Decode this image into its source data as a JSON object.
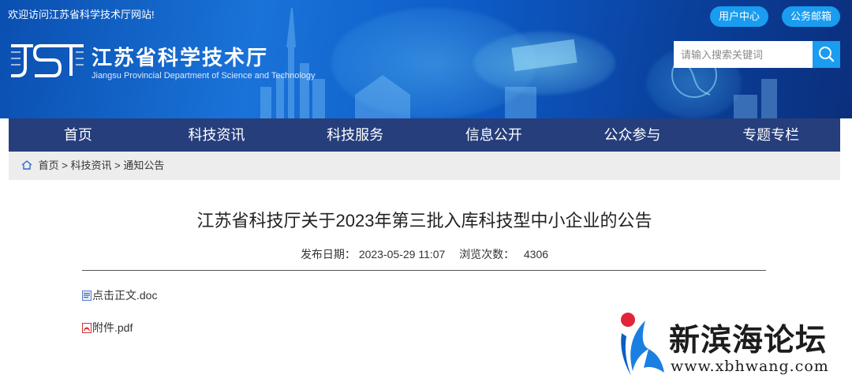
{
  "header": {
    "welcome": "欢迎访问江苏省科学技术厅网站!",
    "user_center": "用户中心",
    "public_mail": "公务邮箱",
    "logo_cn": "江苏省科学技术厅",
    "logo_en": "Jiangsu Provincial Department of Science and Technology"
  },
  "search": {
    "placeholder": "请输入搜索关键词"
  },
  "nav": {
    "items": [
      "首页",
      "科技资讯",
      "科技服务",
      "信息公开",
      "公众参与",
      "专题专栏"
    ]
  },
  "breadcrumb": {
    "home": "首页",
    "sep": ">",
    "level1": "科技资讯",
    "level2": "通知公告"
  },
  "article": {
    "title": "江苏省科技厅关于2023年第三批入库科技型中小企业的公告",
    "date_label": "发布日期：",
    "date": "2023-05-29 11:07",
    "views_label": "浏览次数：",
    "views": "4306",
    "attachments": [
      {
        "label": "点击正文.doc",
        "icon": "doc-file-icon"
      },
      {
        "label": "附件.pdf",
        "icon": "pdf-file-icon"
      }
    ]
  },
  "watermark": {
    "cn": "新滨海论坛",
    "url": "www.xbhwang.com"
  },
  "colors": {
    "banner": "#1a73d9",
    "nav": "#263e7b",
    "accent": "#1a9cf0",
    "breadcrumb_bg": "#ededed"
  }
}
